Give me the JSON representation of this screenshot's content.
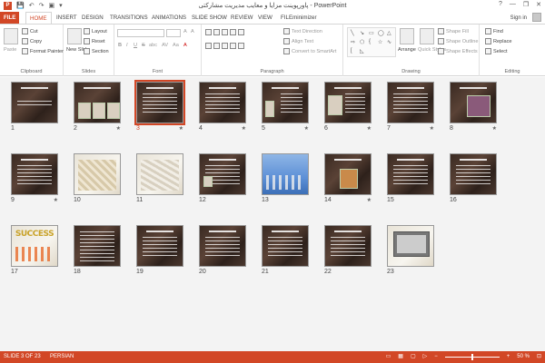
{
  "app": {
    "title": "پاورپوینت مزایا و معایب مدیریت مشارکتی - PowerPoint",
    "brand_color": "#d24726"
  },
  "window_controls": [
    "?",
    "—",
    "❐",
    "✕"
  ],
  "tabs": [
    {
      "label": "FILE"
    },
    {
      "label": "HOME"
    },
    {
      "label": "INSERT"
    },
    {
      "label": "DESIGN"
    },
    {
      "label": "TRANSITIONS"
    },
    {
      "label": "ANIMATIONS"
    },
    {
      "label": "SLIDE SHOW"
    },
    {
      "label": "REVIEW"
    },
    {
      "label": "VIEW"
    },
    {
      "label": "FILEminimizer"
    }
  ],
  "signin": "Sign in",
  "ribbon": {
    "clipboard": {
      "paste": "Paste",
      "cut": "Cut",
      "copy": "Copy",
      "format_painter": "Format Painter",
      "label": "Clipboard"
    },
    "slides": {
      "new_slide": "New Slide",
      "layout": "Layout",
      "reset": "Reset",
      "section": "Section",
      "label": "Slides"
    },
    "font": {
      "label": "Font",
      "bold": "B",
      "italic": "I",
      "underline": "U",
      "strike": "S",
      "shadow": "abc",
      "spacing": "AV",
      "case": "Aa",
      "color": "A",
      "grow": "A",
      "shrink": "A"
    },
    "paragraph": {
      "text_direction": "Text Direction",
      "align_text": "Align Text",
      "convert_smartart": "Convert to SmartArt",
      "label": "Paragraph"
    },
    "drawing": {
      "arrange": "Arrange",
      "quick_styles": "Quick Styles",
      "shape_fill": "Shape Fill",
      "shape_outline": "Shape Outline",
      "shape_effects": "Shape Effects",
      "label": "Drawing"
    },
    "editing": {
      "find": "Find",
      "replace": "Replace",
      "select": "Select",
      "label": "Editing"
    }
  },
  "slides": [
    {
      "n": "1",
      "star": ""
    },
    {
      "n": "2",
      "star": "★"
    },
    {
      "n": "3",
      "star": "★"
    },
    {
      "n": "4",
      "star": "★"
    },
    {
      "n": "5",
      "star": "★"
    },
    {
      "n": "6",
      "star": "★"
    },
    {
      "n": "7",
      "star": "★"
    },
    {
      "n": "8",
      "star": "★"
    },
    {
      "n": "9",
      "star": "★"
    },
    {
      "n": "10",
      "star": ""
    },
    {
      "n": "11",
      "star": ""
    },
    {
      "n": "12",
      "star": ""
    },
    {
      "n": "13",
      "star": ""
    },
    {
      "n": "14",
      "star": "★"
    },
    {
      "n": "15",
      "star": ""
    },
    {
      "n": "16",
      "star": ""
    },
    {
      "n": "17",
      "star": ""
    },
    {
      "n": "18",
      "star": ""
    },
    {
      "n": "19",
      "star": ""
    },
    {
      "n": "20",
      "star": ""
    },
    {
      "n": "21",
      "star": ""
    },
    {
      "n": "22",
      "star": ""
    },
    {
      "n": "23",
      "star": ""
    }
  ],
  "slide17_text": "SUCCESS",
  "status": {
    "slide_counter": "SLIDE 3 OF 23",
    "language": "PERSIAN",
    "zoom": "50 %",
    "zoom_fraction": 0.5
  }
}
